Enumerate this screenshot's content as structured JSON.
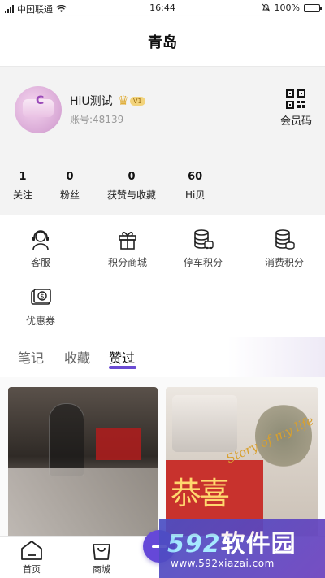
{
  "status_bar": {
    "carrier": "中国联通",
    "time": "16:44",
    "battery_text": "100%",
    "battery_level": 1.0
  },
  "header": {
    "title": "青岛"
  },
  "profile": {
    "username": "HiU测试",
    "vip_tag": "V1",
    "account_label": "账号:48139",
    "member_code_label": "会员码"
  },
  "stats": [
    {
      "value": "1",
      "label": "关注"
    },
    {
      "value": "0",
      "label": "粉丝"
    },
    {
      "value": "0",
      "label": "获赞与收藏"
    },
    {
      "value": "60",
      "label": "Hi贝"
    }
  ],
  "menu": [
    {
      "label": "客服",
      "icon": "headset-icon"
    },
    {
      "label": "积分商城",
      "icon": "gift-icon"
    },
    {
      "label": "停车积分",
      "icon": "parking-coins-icon"
    },
    {
      "label": "消费积分",
      "icon": "coin-stack-icon"
    },
    {
      "label": "优惠券",
      "icon": "coupon-icon"
    }
  ],
  "tabs": [
    {
      "label": "笔记",
      "active": false
    },
    {
      "label": "收藏",
      "active": false
    },
    {
      "label": "赞过",
      "active": true
    }
  ],
  "feed": {
    "right_card_text": "恭喜",
    "right_card_script": "Story of my life"
  },
  "bottom_nav": [
    {
      "label": "首页",
      "icon": "home-icon"
    },
    {
      "label": "商城",
      "icon": "shopping-bag-icon"
    }
  ],
  "watermark": {
    "brand": "592软件园",
    "brand_num": "592",
    "brand_text": "软件园",
    "url": "www.592xiazai.com"
  },
  "colors": {
    "accent": "#6548d8",
    "tab_underline": "#6a4bd3",
    "vip_gold": "#e0ae3a"
  }
}
